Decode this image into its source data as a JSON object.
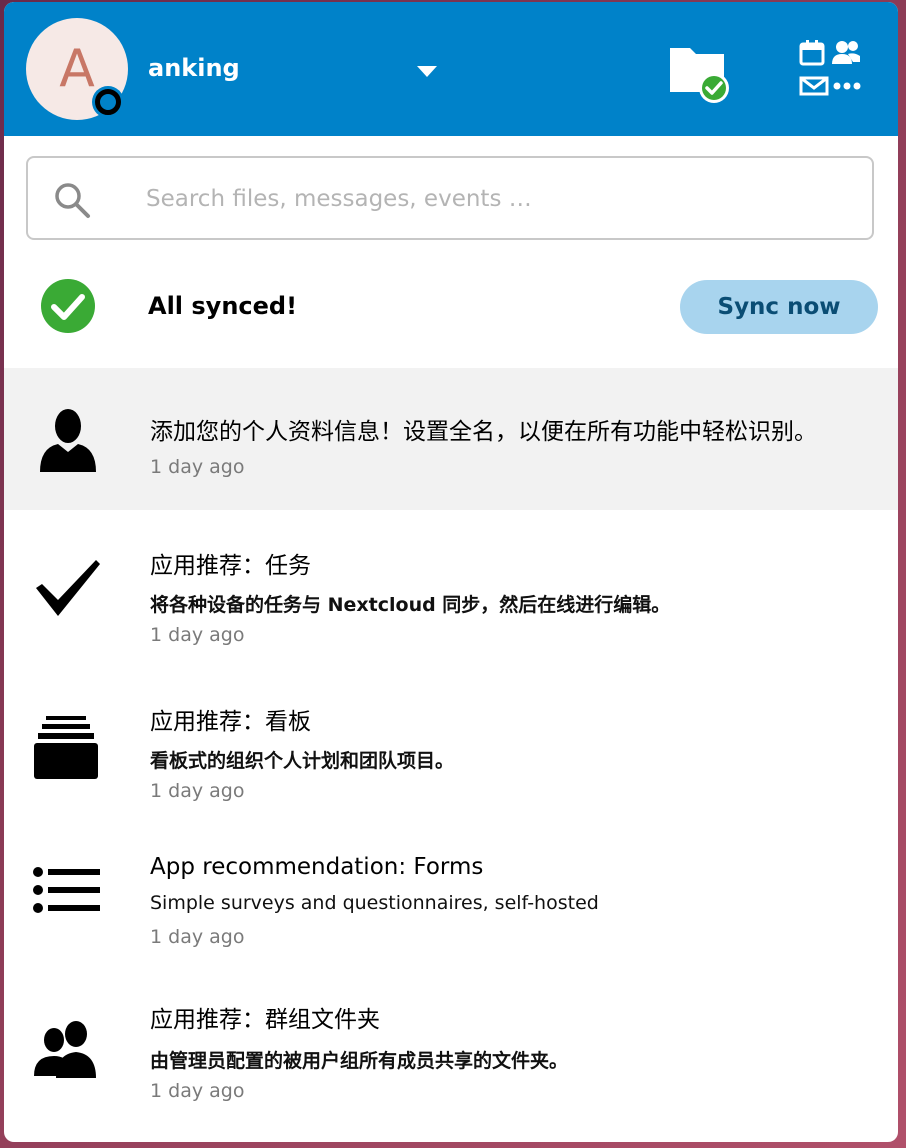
{
  "header": {
    "avatar_initial": "A",
    "username": "anking",
    "accent_color": "#0082c9"
  },
  "search": {
    "placeholder": "Search files, messages, events …",
    "value": ""
  },
  "sync": {
    "status": "All synced!",
    "button_label": "Sync now"
  },
  "activities": [
    {
      "icon": "user-profile-icon",
      "title": "添加您的个人资料信息！设置全名，以便在所有功能中轻松识别。",
      "description": "",
      "time": "1 day ago"
    },
    {
      "icon": "checkmark-icon",
      "title": "应用推荐：任务",
      "description": "将各种设备的任务与 Nextcloud 同步，然后在线进行编辑。",
      "time": "1 day ago"
    },
    {
      "icon": "deck-cards-icon",
      "title": "应用推荐：看板",
      "description": "看板式的组织个人计划和团队项目。",
      "time": "1 day ago"
    },
    {
      "icon": "list-icon",
      "title": "App recommendation: Forms",
      "description": "Simple surveys and questionnaires, self-hosted",
      "time": "1 day ago"
    },
    {
      "icon": "group-folder-icon",
      "title": "应用推荐：群组文件夹",
      "description": "由管理员配置的被用户组所有成员共享的文件夹。",
      "time": "1 day ago"
    }
  ]
}
